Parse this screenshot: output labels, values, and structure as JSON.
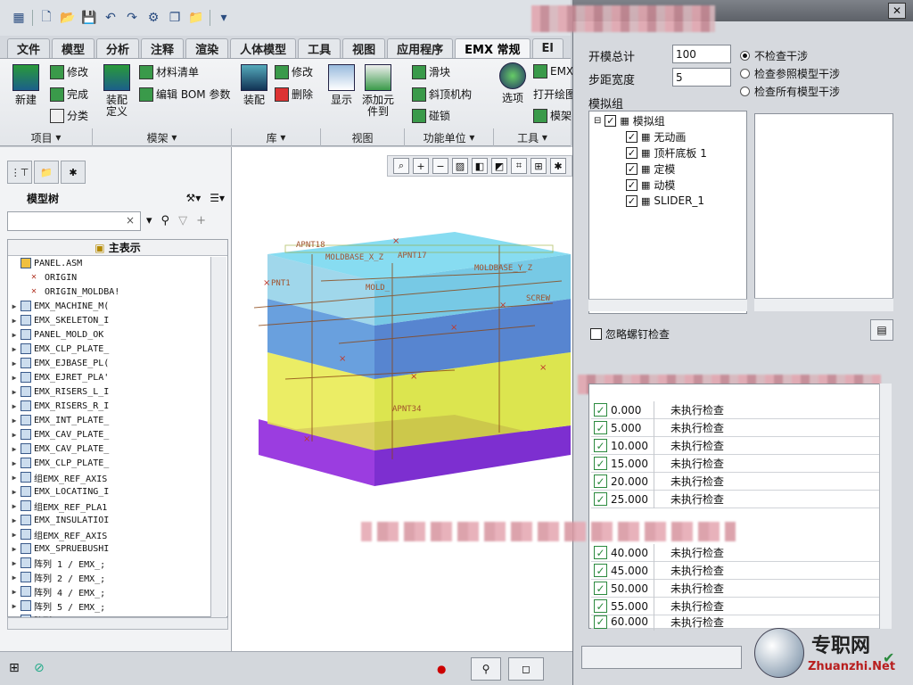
{
  "quick_access": {
    "icons": [
      "layers-icon",
      "new-icon",
      "open-icon",
      "save-icon",
      "undo-icon",
      "redo-icon",
      "regenerate-icon",
      "windows-icon",
      "folder-icon",
      "customize-icon"
    ]
  },
  "tabs": [
    "文件",
    "模型",
    "分析",
    "注释",
    "渲染",
    "人体模型",
    "工具",
    "视图",
    "应用程序",
    "EMX 常规",
    "El"
  ],
  "ribbon": {
    "new": "新建",
    "modify1": "修改",
    "complete": "完成",
    "classify": "分类",
    "assembly_def": "装配\n定义",
    "bom": "材料清单",
    "edit_bom": "编辑 BOM 参数",
    "assemble": "装配",
    "modify2": "修改",
    "delete": "删除",
    "display": "显示",
    "add_part": "添加元\n件到",
    "slider": "滑块",
    "lifter": "斜顶机构",
    "lock": "碰锁",
    "options": "选项",
    "emx": "EMX",
    "open_drawing": "打开绘图",
    "mold": "模架",
    "groups": [
      "项目",
      "模架",
      "库",
      "视图",
      "功能单位",
      "工具"
    ]
  },
  "left_panel": {
    "title": "模型树",
    "column": "主表示",
    "items": [
      {
        "label": "PANEL.ASM",
        "exp": ""
      },
      {
        "label": "ORIGIN",
        "exp": ""
      },
      {
        "label": "ORIGIN_MOLDBA!",
        "exp": ""
      },
      {
        "label": "EMX_MACHINE_M(",
        "exp": "▶"
      },
      {
        "label": "EMX_SKELETON_I",
        "exp": "▶"
      },
      {
        "label": "PANEL_MOLD_OK",
        "exp": "▶"
      },
      {
        "label": "EMX_CLP_PLATE_",
        "exp": "▶"
      },
      {
        "label": "EMX_EJBASE_PL(",
        "exp": "▶"
      },
      {
        "label": "EMX_EJRET_PLA'",
        "exp": "▶"
      },
      {
        "label": "EMX_RISERS_L_I",
        "exp": "▶"
      },
      {
        "label": "EMX_RISERS_R_I",
        "exp": "▶"
      },
      {
        "label": "EMX_INT_PLATE_",
        "exp": "▶"
      },
      {
        "label": "EMX_CAV_PLATE_",
        "exp": "▶"
      },
      {
        "label": "EMX_CAV_PLATE_",
        "exp": "▶"
      },
      {
        "label": "EMX_CLP_PLATE_",
        "exp": "▶"
      },
      {
        "label": "组EMX_REF_AXIS",
        "exp": "▶"
      },
      {
        "label": "EMX_LOCATING_I",
        "exp": "▶"
      },
      {
        "label": "组EMX_REF_PLA1",
        "exp": "▶"
      },
      {
        "label": "EMX_INSULATIOI",
        "exp": "▶"
      },
      {
        "label": "组EMX_REF_AXIS",
        "exp": "▶"
      },
      {
        "label": "EMX_SPRUEBUSHI",
        "exp": "▶"
      },
      {
        "label": "阵列 1 / EMX_;",
        "exp": "▶"
      },
      {
        "label": "阵列 2 / EMX_;",
        "exp": "▶"
      },
      {
        "label": "阵列 4 / EMX_;",
        "exp": "▶"
      },
      {
        "label": "阵列 5 / EMX_;",
        "exp": "▶"
      },
      {
        "label": "阵列 6 / EMX_;",
        "exp": "▶"
      }
    ]
  },
  "dialog": {
    "title": "",
    "open_total_label": "开模总计",
    "open_total": "100",
    "step_label": "步距宽度",
    "step": "5",
    "radio": [
      "不检查干涉",
      "检查参照模型干涉",
      "检查所有模型干涉"
    ],
    "group_label": "模拟组",
    "group_root": "模拟组",
    "group_items": [
      "无动画",
      "顶杆底板 1",
      "定模",
      "动模",
      "SLIDER_1"
    ],
    "ignore_screw": "忽略螺钉检查",
    "rows": [
      {
        "v": "0.000",
        "s": "未执行检查"
      },
      {
        "v": "5.000",
        "s": "未执行检查"
      },
      {
        "v": "10.000",
        "s": "未执行检查"
      },
      {
        "v": "15.000",
        "s": "未执行检查"
      },
      {
        "v": "20.000",
        "s": "未执行检查"
      },
      {
        "v": "25.000",
        "s": "未执行检查"
      },
      {
        "v": "40.000",
        "s": "未执行检查"
      },
      {
        "v": "45.000",
        "s": "未执行检查"
      },
      {
        "v": "50.000",
        "s": "未执行检查"
      },
      {
        "v": "55.000",
        "s": "未执行检查"
      },
      {
        "v": "60.000",
        "s": "未执行检查"
      }
    ]
  },
  "gfx_labels": {
    "l1": "MOLDBASE_X_Z",
    "l2": "MOLDBASE_Y_Z",
    "l3": "APNT18",
    "l4": "APNT17",
    "l5": "SCREW",
    "l6": "APNT34",
    "l7": "MOLD_",
    "l8": "PNT1"
  },
  "watermark": {
    "cn": "专职网",
    "url": "Zhuanzhi.Net"
  }
}
